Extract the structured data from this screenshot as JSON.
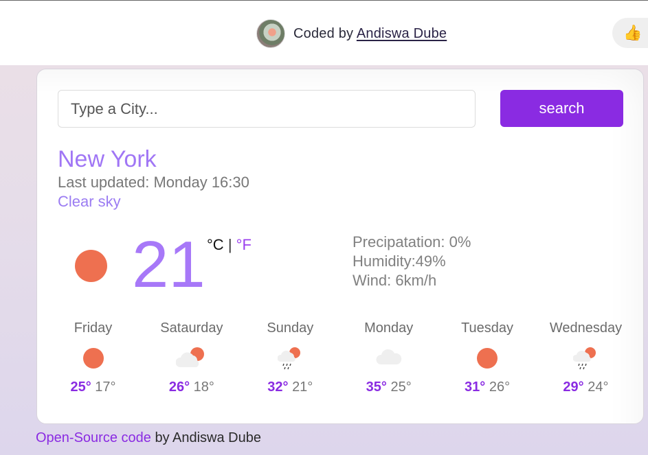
{
  "header": {
    "credit_prefix": "Coded by",
    "credit_author": "Andiswa Dube",
    "like_icon": "thumbs-up-icon"
  },
  "search": {
    "placeholder": "Type a City...",
    "value": "",
    "button_label": "search"
  },
  "current": {
    "city": "New York",
    "last_updated": "Last updated: Monday 16:30",
    "condition": "Clear sky",
    "icon": "sun-icon",
    "temperature": "21",
    "unit_c": "°C",
    "unit_sep": "|",
    "unit_f": "°F",
    "precipitation": "Precipatation: 0%",
    "humidity": "Humidity:49%",
    "wind": "Wind: 6km/h"
  },
  "forecast": [
    {
      "day": "Friday",
      "icon": "sun-icon",
      "max": "25°",
      "min": "17°"
    },
    {
      "day": "Sataurday",
      "icon": "cloud-sun-icon",
      "max": "26°",
      "min": "18°"
    },
    {
      "day": "Sunday",
      "icon": "rain-cloud-sun-icon",
      "max": "32°",
      "min": "21°"
    },
    {
      "day": "Monday",
      "icon": "cloud-icon",
      "max": "35°",
      "min": "25°"
    },
    {
      "day": "Tuesday",
      "icon": "sun-icon",
      "max": "31°",
      "min": "26°"
    },
    {
      "day": "Wednesday",
      "icon": "rain-cloud-sun-icon",
      "max": "29°",
      "min": "24°"
    }
  ],
  "footer": {
    "link_text": "Open-Source code",
    "suffix": " by Andiswa Dube"
  },
  "colors": {
    "accent": "#8a2be2",
    "city": "#a076f5",
    "sun": "#ee7050",
    "cloud": "#efefef"
  }
}
